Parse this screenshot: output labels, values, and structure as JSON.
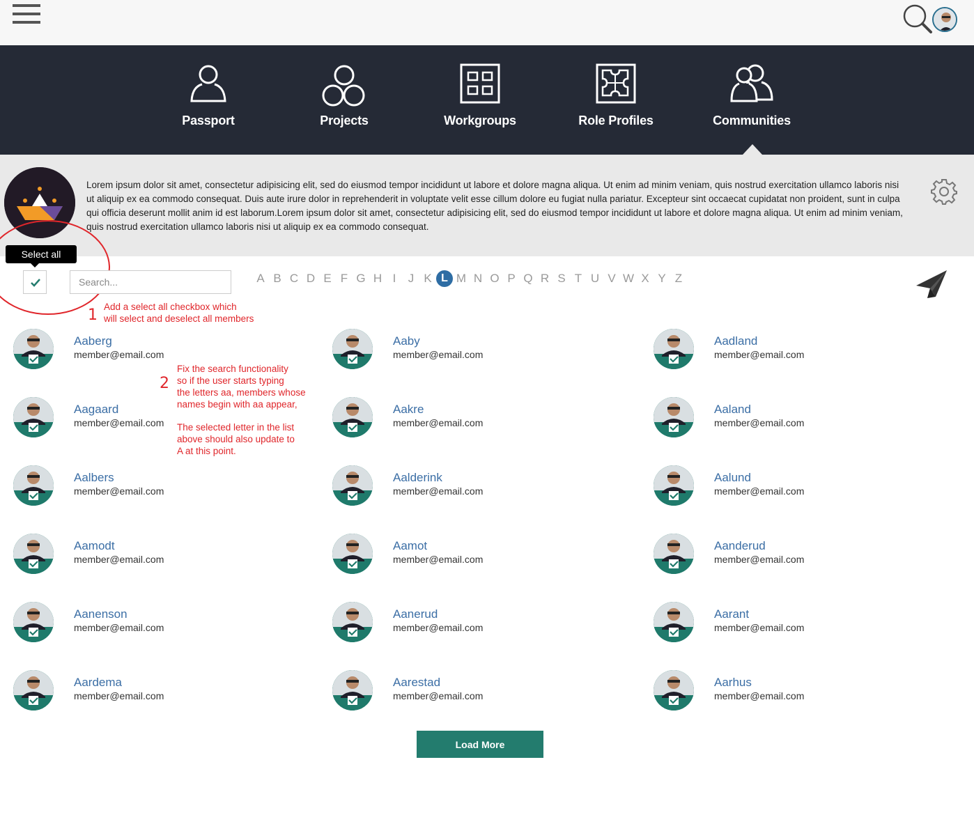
{
  "header": {
    "menu_icon": "hamburger-icon",
    "search_icon": "search-icon",
    "avatar_icon": "user-avatar"
  },
  "nav": {
    "items": [
      {
        "label": "Passport",
        "icon": "person-icon"
      },
      {
        "label": "Projects",
        "icon": "projects-icon"
      },
      {
        "label": "Workgroups",
        "icon": "grid-icon"
      },
      {
        "label": "Role Profiles",
        "icon": "puzzle-icon"
      },
      {
        "label": "Communities",
        "icon": "people-icon",
        "active": true
      }
    ]
  },
  "community": {
    "description": "Lorem ipsum dolor sit amet, consectetur adipisicing elit, sed do eiusmod tempor incididunt ut labore et dolore magna aliqua. Ut enim ad minim veniam, quis nostrud exercitation ullamco laboris nisi ut aliquip ex ea commodo consequat. Duis aute irure dolor in reprehenderit in voluptate velit esse cillum dolore eu fugiat nulla pariatur. Excepteur sint occaecat cupidatat non proident, sunt in culpa qui officia deserunt mollit anim id est laborum.Lorem ipsum dolor sit amet, consectetur adipisicing elit, sed do eiusmod tempor incididunt ut labore et dolore magna aliqua. Ut enim ad minim veniam, quis nostrud exercitation ullamco laboris nisi ut aliquip ex ea commodo consequat.",
    "settings_icon": "gear-icon"
  },
  "toolbar": {
    "select_all_tooltip": "Select all",
    "search_placeholder": "Search...",
    "letters": [
      "A",
      "B",
      "C",
      "D",
      "E",
      "F",
      "G",
      "H",
      "I",
      "J",
      "K",
      "L",
      "M",
      "N",
      "O",
      "P",
      "Q",
      "R",
      "S",
      "T",
      "U",
      "V",
      "W",
      "X",
      "Y",
      "Z"
    ],
    "active_letter": "L",
    "send_icon": "paper-plane-icon"
  },
  "annotations": {
    "note1_number": "1",
    "note1_line1": "Add a select all checkbox which",
    "note1_line2": "will select and deselect all members",
    "note2_number": "2",
    "note2_line1": "Fix the search functionality",
    "note2_line2": "so if the user starts typing",
    "note2_line3": "the letters aa, members whose",
    "note2_line4": "names begin with aa appear,",
    "note2_line5": "The selected letter in the list",
    "note2_line6": "above should also update to",
    "note2_line7": "A at this point."
  },
  "members": [
    {
      "name": "Aaberg",
      "email": "member@email.com"
    },
    {
      "name": "Aaby",
      "email": "member@email.com"
    },
    {
      "name": "Aadland",
      "email": "member@email.com"
    },
    {
      "name": "Aagaard",
      "email": "member@email.com"
    },
    {
      "name": "Aakre",
      "email": "member@email.com"
    },
    {
      "name": "Aaland",
      "email": "member@email.com"
    },
    {
      "name": "Aalbers",
      "email": "member@email.com"
    },
    {
      "name": "Aalderink",
      "email": "member@email.com"
    },
    {
      "name": "Aalund",
      "email": "member@email.com"
    },
    {
      "name": "Aamodt",
      "email": "member@email.com"
    },
    {
      "name": "Aamot",
      "email": "member@email.com"
    },
    {
      "name": "Aanderud",
      "email": "member@email.com"
    },
    {
      "name": "Aanenson",
      "email": "member@email.com"
    },
    {
      "name": "Aanerud",
      "email": "member@email.com"
    },
    {
      "name": "Aarant",
      "email": "member@email.com"
    },
    {
      "name": "Aardema",
      "email": "member@email.com"
    },
    {
      "name": "Aarestad",
      "email": "member@email.com"
    },
    {
      "name": "Aarhus",
      "email": "member@email.com"
    }
  ],
  "load_more_label": "Load More",
  "colors": {
    "nav_bg": "#252a36",
    "accent_teal": "#237c6e",
    "link_blue": "#3b6ea5",
    "active_letter_bg": "#2e6da4",
    "annotation_red": "#e0262b"
  }
}
